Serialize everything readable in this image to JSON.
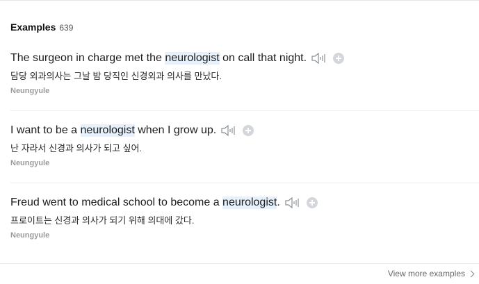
{
  "examples_section": {
    "title": "Examples",
    "count": "639",
    "items": [
      {
        "sentence_before": "The surgeon in charge met the ",
        "highlight": "neurologist",
        "sentence_after": " on call that night.",
        "translation": "담당 외과의사는 그날 밤 당직인 신경외과 의사를 만났다.",
        "source": "Neungyule",
        "audio_icon": "speaker-icon",
        "add_icon": "plus-circle-icon"
      },
      {
        "sentence_before": "I want to be a ",
        "highlight": "neurologist",
        "sentence_after": " when I grow up.",
        "translation": "난 자라서 신경과 의사가 되고 싶어.",
        "source": "Neungyule",
        "audio_icon": "speaker-icon",
        "add_icon": "plus-circle-icon"
      },
      {
        "sentence_before": "Freud went to medical school to become a ",
        "highlight": "neurologist",
        "sentence_after": ".",
        "translation": "프로이트는 신경과 의사가 되기 위해 의대에 갔다.",
        "source": "Neungyule",
        "audio_icon": "speaker-icon",
        "add_icon": "plus-circle-icon"
      }
    ],
    "view_more_label": "View more examples"
  },
  "colors": {
    "highlight_bg": "#e6f1fb",
    "text": "#1d1d1d",
    "muted": "#9b9b9b"
  }
}
